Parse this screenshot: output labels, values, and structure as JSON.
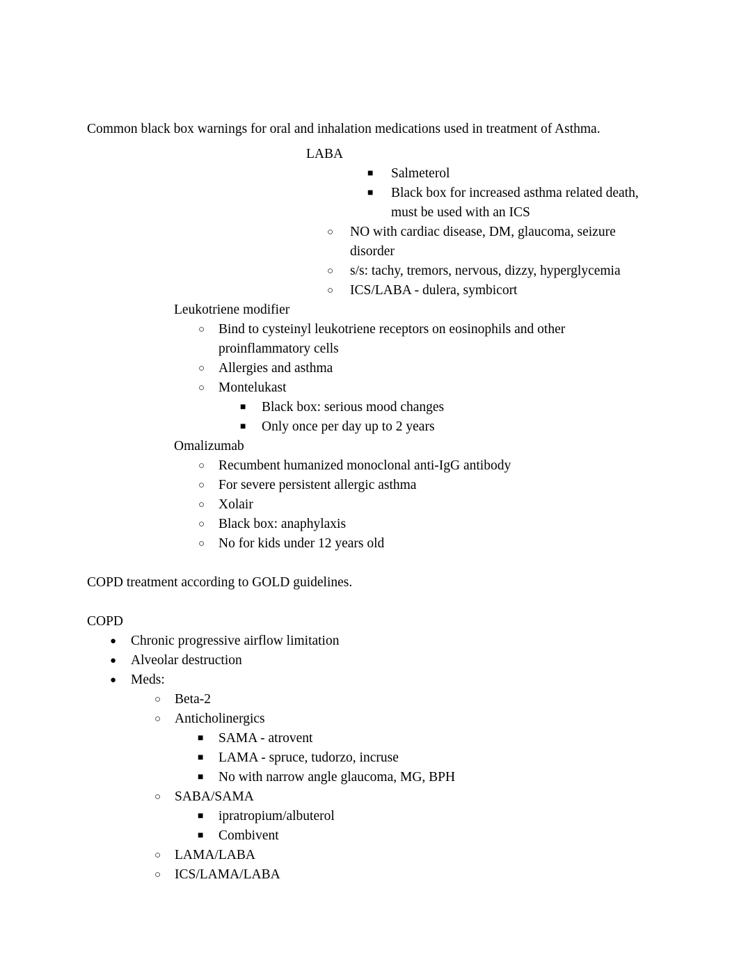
{
  "document": {
    "intro_asthma": "Common black box warnings for oral and inhalation medications used in treatment of Asthma.",
    "intro_copd": "COPD treatment according to GOLD guidelines.",
    "bullet_glyphs": {
      "disc": "●",
      "circle": "○",
      "square": "■"
    },
    "asthma": {
      "laba": {
        "heading": "LABA",
        "square_items": [
          "Salmeterol",
          "Black box for increased asthma related death, must be used with an ICS"
        ],
        "circle_items": [
          "NO with cardiac disease, DM, glaucoma, seizure disorder",
          "s/s: tachy, tremors, nervous, dizzy, hyperglycemia",
          "ICS/LABA - dulera, symbicort"
        ]
      },
      "leukotriene": {
        "heading": "Leukotriene modifier",
        "circle_items": [
          "Bind to cysteinyl leukotriene receptors on eosinophils and other proinflammatory cells",
          "Allergies and asthma",
          "Montelukast"
        ],
        "montelukast_square_items": [
          "Black box: serious mood changes",
          "Only once per day up to 2 years"
        ]
      },
      "omalizumab": {
        "heading": "Omalizumab",
        "circle_items": [
          "Recumbent humanized monoclonal anti-IgG antibody",
          "For severe persistent allergic asthma",
          "Xolair",
          "Black box: anaphylaxis",
          "No for kids under 12 years old"
        ]
      }
    },
    "copd": {
      "heading": "COPD",
      "disc_items": [
        "Chronic progressive airflow limitation",
        "Alveolar destruction",
        "Meds:"
      ],
      "meds": {
        "beta2": "Beta-2",
        "anticholinergics": "Anticholinergics",
        "anticholinergics_square_items": [
          "SAMA - atrovent",
          "LAMA - spruce, tudorzo, incruse",
          "No with narrow angle glaucoma, MG, BPH"
        ],
        "saba_sama": "SABA/SAMA",
        "saba_sama_square_items": [
          "ipratropium/albuterol",
          "Combivent"
        ],
        "lama_laba": "LAMA/LABA",
        "ics_lama_laba": "ICS/LAMA/LABA"
      }
    }
  },
  "colors": {
    "text": "#000000",
    "background": "#ffffff"
  }
}
